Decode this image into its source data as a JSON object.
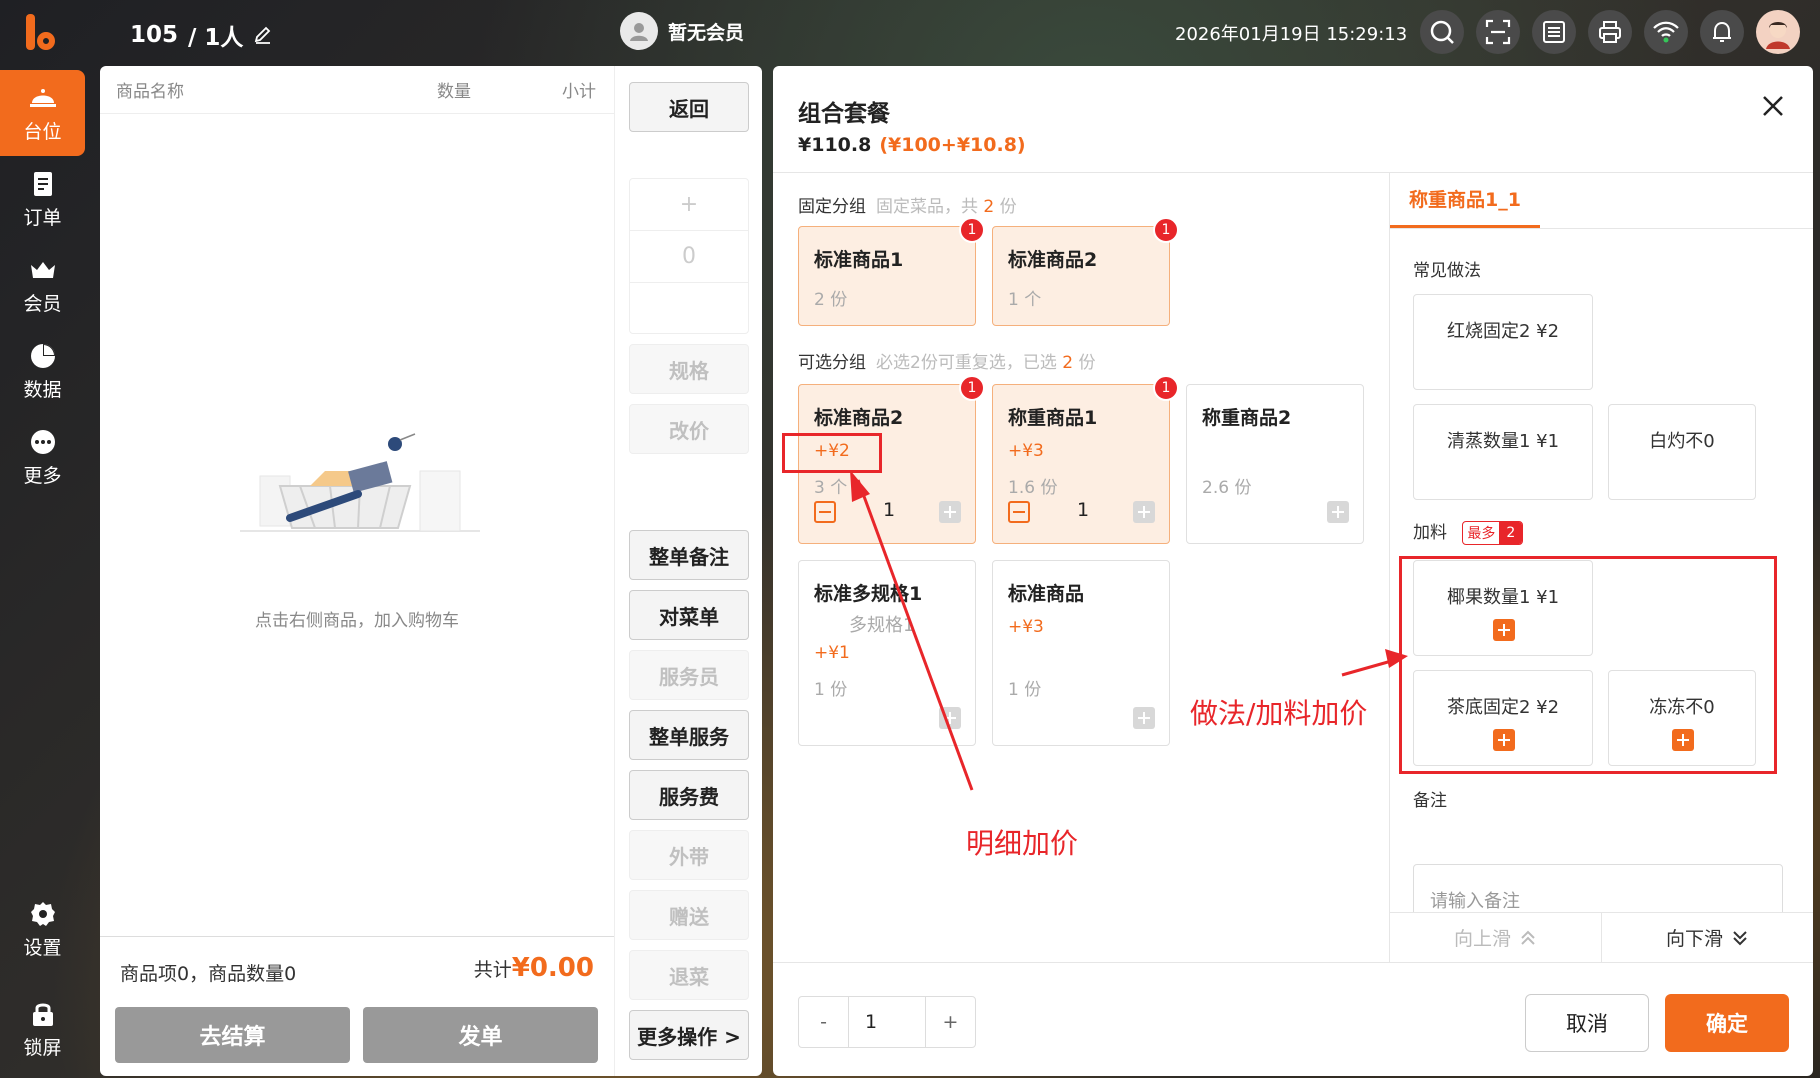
{
  "header": {
    "table": "105",
    "guests": "/ 1人",
    "member": "暂无会员",
    "datetime": "2026年01月19日 15:29:13"
  },
  "sidebar": {
    "items": [
      {
        "label": "台位",
        "icon": "table-icon",
        "active": true
      },
      {
        "label": "订单",
        "icon": "order-icon"
      },
      {
        "label": "会员",
        "icon": "crown-icon"
      },
      {
        "label": "数据",
        "icon": "pie-chart-icon"
      },
      {
        "label": "更多",
        "icon": "more-dots-icon"
      },
      {
        "label": "设置",
        "icon": "gear-icon"
      },
      {
        "label": "锁屏",
        "icon": "lock-icon"
      }
    ]
  },
  "cart": {
    "col_name": "商品名称",
    "col_qty": "数量",
    "col_subtotal": "小计",
    "empty_text": "点击右侧商品，加入购物车",
    "summary": "商品项0，商品数量0",
    "total_label": "共计",
    "total_value": "¥0.00",
    "checkout": "去结算",
    "send": "发单"
  },
  "actions": {
    "back": "返回",
    "plus": "+",
    "qty": "0",
    "spec": "规格",
    "price_change": "改价",
    "order_note": "整单备注",
    "check_order": "对菜单",
    "waiter": "服务员",
    "order_service": "整单服务",
    "service_fee": "服务费",
    "takeout": "外带",
    "gift": "赠送",
    "return": "退菜",
    "more": "更多操作 >"
  },
  "dialog": {
    "title": "组合套餐",
    "price": "¥110.8",
    "price_detail": "(¥100+¥10.8)",
    "fixed_group": {
      "label": "固定分组",
      "hint_a": "固定菜品，共",
      "hint_n": "2",
      "hint_b": "份",
      "items": [
        {
          "name": "标准商品1",
          "sub": "2 份",
          "badge": "1"
        },
        {
          "name": "标准商品2",
          "sub": "1 个",
          "badge": "1"
        }
      ]
    },
    "optional_group": {
      "label": "可选分组",
      "hint_a": "必选2份可重复选，已选",
      "hint_n": "2",
      "hint_b": "份",
      "items": [
        {
          "name": "标准商品2",
          "add": "+¥2",
          "sub": "3 个",
          "qty": "1",
          "badge": "1"
        },
        {
          "name": "称重商品1",
          "add": "+¥3",
          "sub": "1.6 份",
          "qty": "1",
          "badge": "1"
        },
        {
          "name": "称重商品2",
          "sub": "2.6 份"
        },
        {
          "name": "标准多规格1",
          "spec": "多规格1",
          "add": "+¥1",
          "sub": "1 份"
        },
        {
          "name": "标准商品",
          "add": "+¥3",
          "sub": "1 份"
        }
      ]
    },
    "right": {
      "tab": "称重商品1_1",
      "methods_label": "常见做法",
      "methods": [
        "红烧固定2 ¥2",
        "清蒸数量1 ¥1",
        "白灼不0"
      ],
      "toppings_label": "加料",
      "max_label": "最多",
      "max_value": "2",
      "toppings": [
        "椰果数量1 ¥1",
        "茶底固定2 ¥2",
        "冻冻不0"
      ],
      "remark_label": "备注",
      "remark_placeholder": "请输入备注",
      "scroll_up": "向上滑",
      "scroll_down": "向下滑"
    },
    "footer": {
      "minus": "-",
      "qty": "1",
      "plus": "+",
      "cancel": "取消",
      "confirm": "确定"
    }
  },
  "annotations": {
    "detail_price": "明细加价",
    "method_price": "做法/加料加价"
  },
  "colors": {
    "accent": "#f26b1d",
    "badge_red": "#e8262a",
    "annotation_red": "#e8262a"
  }
}
